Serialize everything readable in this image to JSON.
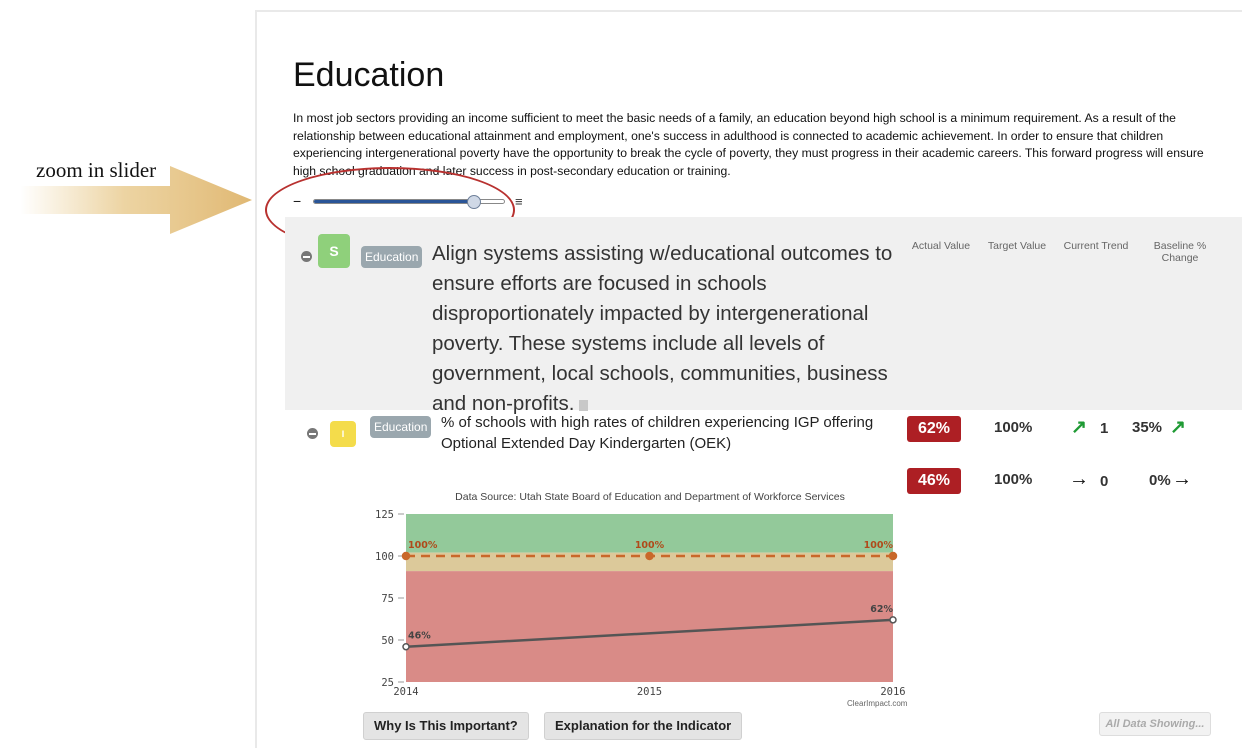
{
  "annotation": {
    "label": "zoom in slider",
    "arrow_color": "#e8c98b",
    "circle_color": "#b8312f"
  },
  "page": {
    "title": "Education",
    "description": "In most job sectors providing an income sufficient to meet the basic needs of a family, an education beyond high school is a minimum requirement. As a result of the relationship between educational attainment and employment, one's success in adulthood is connected to academic achievement. In order to ensure that children experiencing intergenerational poverty have the opportunity to break the cycle of poverty, they must progress in their academic careers. This forward progress will ensure high school graduation and later success in post-secondary education or training."
  },
  "zoom_slider": {
    "minus_label": "−",
    "lines_icon": "≡",
    "level_fraction": 0.84,
    "icon": "slider-handle-icon"
  },
  "columns": {
    "actual": "Actual Value",
    "target": "Target Value",
    "trend": "Current Trend",
    "baseline": "Baseline % Change"
  },
  "strategy": {
    "type_letter": "S",
    "tag": "Education",
    "text": "Align systems assisting w/educational outcomes to ensure efforts are focused in schools disproportionately impacted by intergenerational poverty. These systems include all levels of government, local schools, communities, business and non-profits.",
    "icon": "document-icon"
  },
  "measure": {
    "type_letter": "I",
    "tag": "Education",
    "text": "% of schools with high rates of children experiencing IGP offering Optional Extended Day Kindergarten (OEK)",
    "rows": [
      {
        "actual": "62%",
        "target": "100%",
        "trend_arrow": "↗",
        "trend_count": "1",
        "baseline": "35%",
        "baseline_arrow": "↗"
      },
      {
        "actual": "46%",
        "target": "100%",
        "trend_arrow": "→",
        "trend_count": "0",
        "baseline": "0%",
        "baseline_arrow": "→"
      }
    ]
  },
  "buttons": {
    "why": "Why Is This Important?",
    "explanation": "Explanation for the Indicator",
    "all_data": "All Data Showing..."
  },
  "colors": {
    "badge_red": "#ad1f24",
    "trend_green": "#1f9a34",
    "zone_green": "#93c99a",
    "zone_yellow": "#dcc99a",
    "zone_red": "#d98b87",
    "target_line": "#c9682a",
    "actual_line": "#555555"
  },
  "chart_data": {
    "type": "line",
    "title": "Data Source: Utah State Board of Education and Department of Workforce Services",
    "xlabel": "",
    "ylabel": "",
    "x": [
      2014,
      2015,
      2016
    ],
    "xticks": [
      "2014",
      "2015",
      "2016"
    ],
    "yticks": [
      25,
      50,
      75,
      100,
      125
    ],
    "ylim": [
      25,
      125
    ],
    "bands": [
      {
        "name": "green",
        "from": 102,
        "to": 125
      },
      {
        "name": "yellow",
        "from": 91,
        "to": 102
      },
      {
        "name": "red",
        "from": 25,
        "to": 91
      }
    ],
    "series": [
      {
        "name": "Target",
        "style": "dashed",
        "x": [
          2014,
          2015,
          2016
        ],
        "values": [
          100,
          100,
          100
        ],
        "labels": [
          "100%",
          "100%",
          "100%"
        ]
      },
      {
        "name": "Actual",
        "style": "solid",
        "x": [
          2014,
          2016
        ],
        "values": [
          46,
          62
        ],
        "labels": [
          "46%",
          "62%"
        ]
      }
    ],
    "credit": "ClearImpact.com",
    "grid": false
  }
}
